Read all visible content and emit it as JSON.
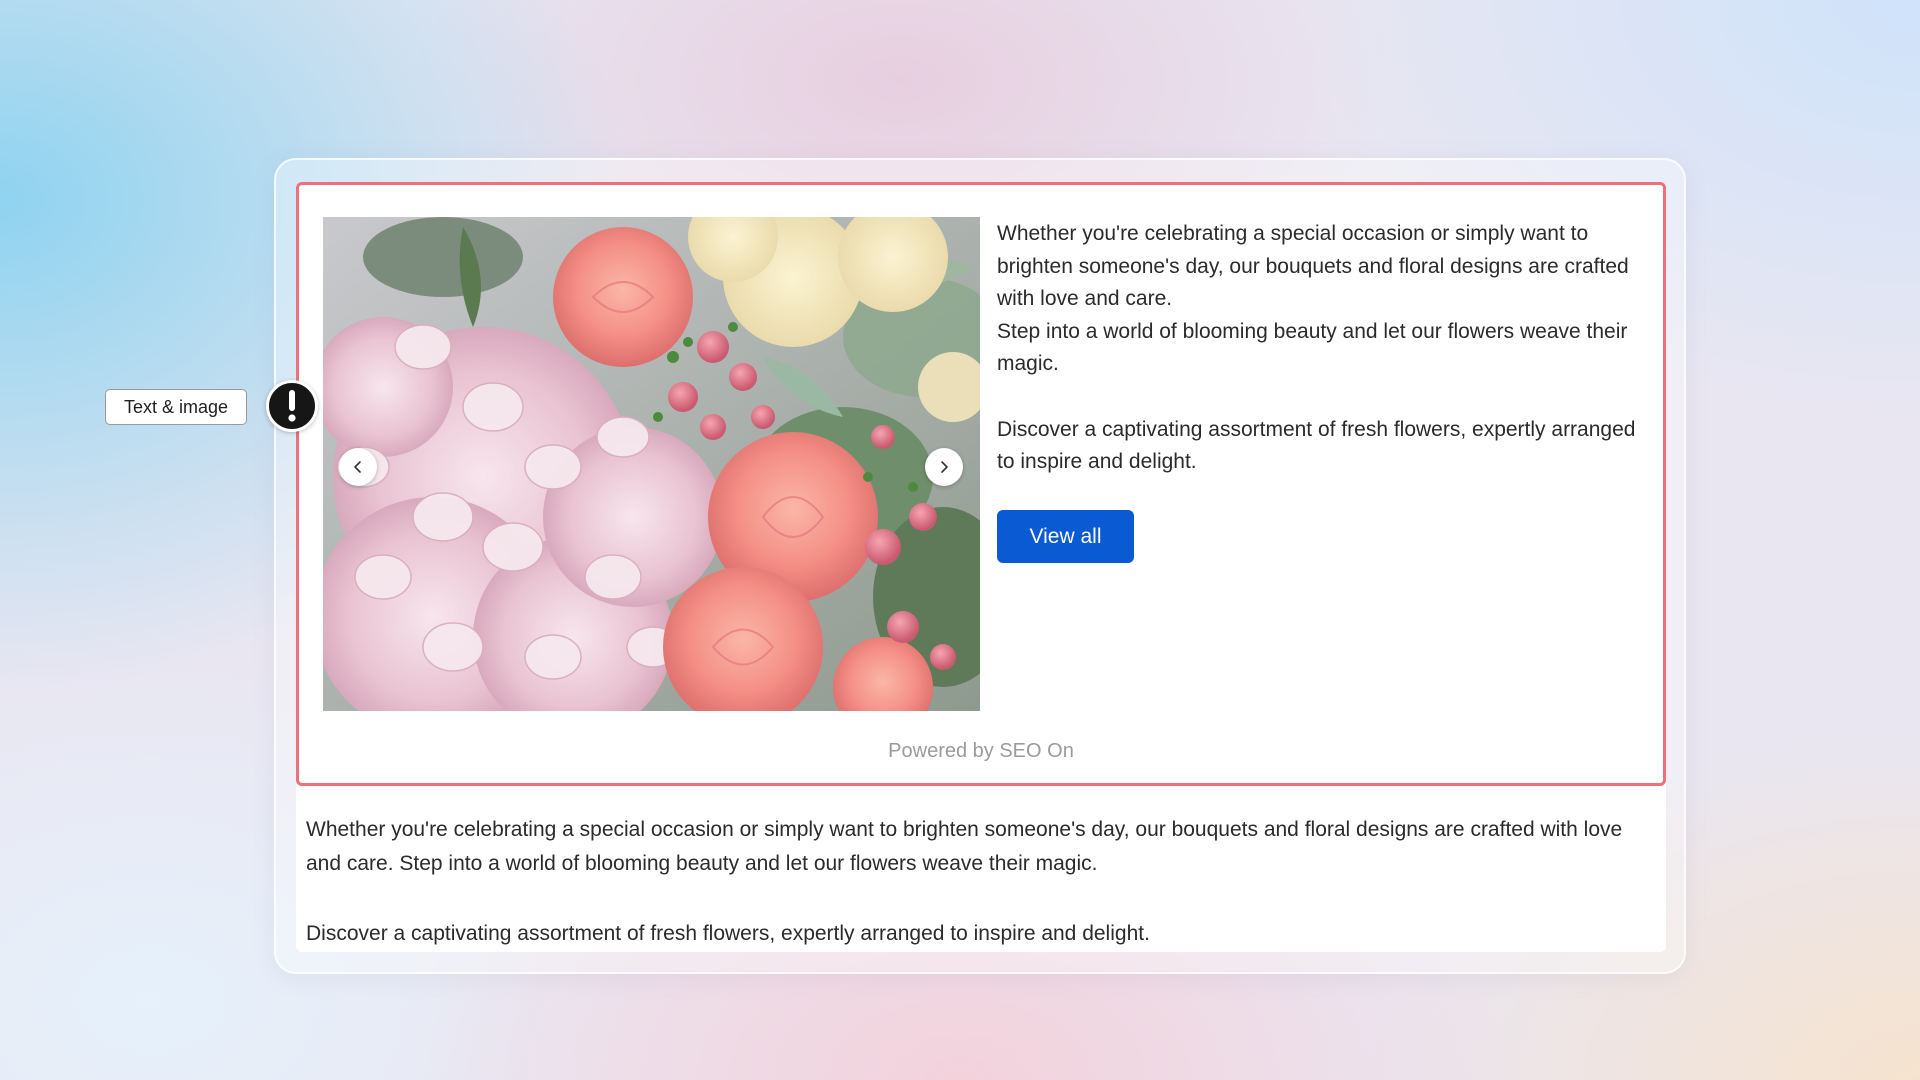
{
  "section_tag": {
    "label": "Text & image",
    "status_icon": "exclamation-icon"
  },
  "carousel": {
    "image_subject": "flower bouquet",
    "prev_icon": "chevron-left-icon",
    "next_icon": "chevron-right-icon"
  },
  "content": {
    "paragraph_1": "Whether you're celebrating a special occasion or simply want to brighten someone's day, our bouquets and floral designs are crafted with love and care.",
    "paragraph_2": "Step into a world of blooming beauty and let our flowers weave their magic.",
    "paragraph_3": "Discover a captivating assortment of fresh flowers, expertly arranged to inspire and delight.",
    "button_label": "View all"
  },
  "footer": {
    "powered_by": "Powered by SEO On"
  },
  "below_section": {
    "paragraph_1": "Whether you're celebrating a special occasion or simply want to brighten someone's day, our bouquets and floral designs are crafted with love and care. Step into a world of blooming beauty and let our flowers weave their magic.",
    "paragraph_2": "Discover a captivating assortment of fresh flowers, expertly arranged to inspire and delight."
  },
  "colors": {
    "accent_button": "#0a5bd3",
    "section_border": "#ef6f7c",
    "badge": "#161616"
  }
}
